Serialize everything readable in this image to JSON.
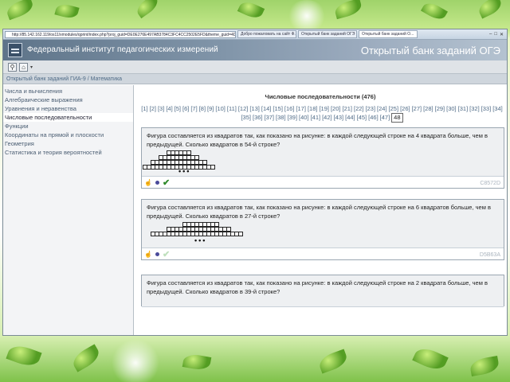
{
  "browser": {
    "address": "http://85.142.162.119/os11/xmodules/qprint/index.php?proj_guid=DE0E276E497AB3784C3FC4CC2502E5FD&theme_guid=4D891B8EB2FE4C029E2071DF011E1...",
    "tabs": [
      {
        "label": "Добро пожаловать на сайт Ф...",
        "active": false
      },
      {
        "label": "Открытый банк заданий ОГЭ",
        "active": false
      },
      {
        "label": "Открытый банк заданий О...",
        "active": true
      }
    ]
  },
  "header": {
    "org_title": "Федеральный институт педагогических измерений",
    "bank_title": "Открытый банк заданий ОГЭ"
  },
  "breadcrumb": "Открытый банк заданий ГИА-9 / Математика",
  "sidebar": {
    "items": [
      {
        "label": "Числа и вычисления",
        "active": false
      },
      {
        "label": "Алгебраические выражения",
        "active": false
      },
      {
        "label": "Уравнения и неравенства",
        "active": false
      },
      {
        "label": "Числовые последовательности",
        "active": true
      },
      {
        "label": "Функции",
        "active": false
      },
      {
        "label": "Координаты на прямой и плоскости",
        "active": false
      },
      {
        "label": "Геометрия",
        "active": false
      },
      {
        "label": "Статистика и теория вероятностей",
        "active": false
      }
    ]
  },
  "content": {
    "section_title": "Числовые последовательности (476)",
    "pages": [
      "[1]",
      "[2]",
      "[3]",
      "[4]",
      "[5]",
      "[6]",
      "[7]",
      "[8]",
      "[9]",
      "[10]",
      "[11]",
      "[12]",
      "[13]",
      "[14]",
      "[15]",
      "[16]",
      "[17]",
      "[18]",
      "[19]",
      "[20]",
      "[21]",
      "[22]",
      "[23]",
      "[24]",
      "[25]",
      "[26]",
      "[27]",
      "[28]",
      "[29]",
      "[30]",
      "[31]",
      "[32]",
      "[33]",
      "[34]",
      "[35]",
      "[36]",
      "[37]",
      "[38]",
      "[39]",
      "[40]",
      "[41]",
      "[42]",
      "[43]",
      "[44]",
      "[45]",
      "[46]",
      "[47]"
    ],
    "current_page": "48",
    "tasks": [
      {
        "text": "Фигура составляется из квадратов так, как показано на рисунке: в каждой следующей строке на 4 квадрата больше, чем в предыдущей. Сколько квадратов в 54-й строке?",
        "id": "C8572D",
        "checked": true
      },
      {
        "text": "Фигура составляется из квадратов так, как показано на рисунке: в каждой следующей строке на 6 квадратов больше, чем в предыдущей. Сколько квадратов в 27-й строке?",
        "id": "D5B63A",
        "checked": false
      },
      {
        "text": "Фигура составляется из квадратов так, как показано на рисунке: в каждой следующей строке на 2 квадрата больше, чем в предыдущей. Сколько квадратов в 39-й строке?",
        "id": "",
        "checked": false
      }
    ]
  },
  "icons": {
    "hand": "hand-icon",
    "eye": "eye-icon",
    "check": "check-icon"
  },
  "colors": {
    "header_bg": "#6f8499",
    "link": "#4e6a86",
    "check": "#2f8a2a"
  }
}
